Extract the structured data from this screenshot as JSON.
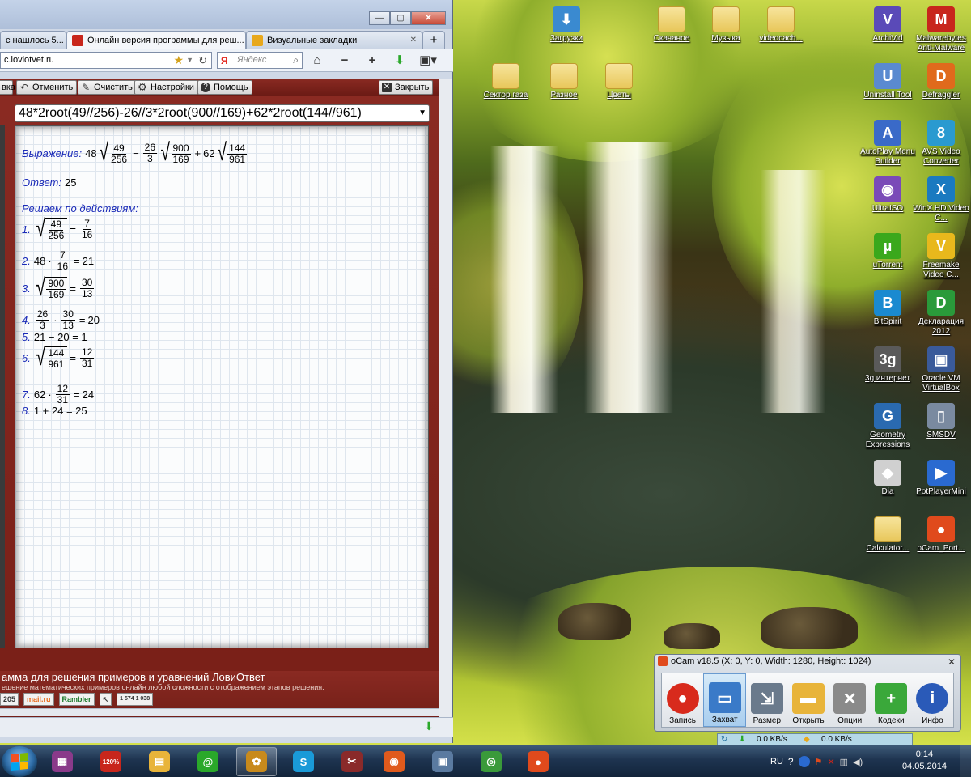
{
  "desktop": {
    "icons": [
      {
        "label": "Загрузки",
        "color": "#3a8ad0",
        "glyph": "⬇"
      },
      {
        "label": "Скачаное",
        "color": "folder",
        "glyph": ""
      },
      {
        "label": "Музыка",
        "color": "folder",
        "glyph": ""
      },
      {
        "label": "videocach...",
        "color": "folder",
        "glyph": ""
      },
      {
        "label": "ArchiVid",
        "color": "#5a4ab8",
        "glyph": "V"
      },
      {
        "label": "Malwarebytes Anti-Malware",
        "color": "#c8261c",
        "glyph": "M"
      },
      {
        "label": "Сектор газа",
        "color": "folder",
        "glyph": ""
      },
      {
        "label": "Разное",
        "color": "folder",
        "glyph": ""
      },
      {
        "label": "Цветы",
        "color": "folder",
        "glyph": ""
      },
      {
        "label": "Uninstall Tool",
        "color": "#5a8ad0",
        "glyph": "U"
      },
      {
        "label": "Defraggler",
        "color": "#e06a1c",
        "glyph": "D"
      },
      {
        "label": "AutoPlay Menu Builder",
        "color": "#3a6ac8",
        "glyph": "A"
      },
      {
        "label": "AVS Video Converter",
        "color": "#2a9ad0",
        "glyph": "8"
      },
      {
        "label": "UltraISO",
        "color": "#7a4ab8",
        "glyph": "◉"
      },
      {
        "label": "WinX HD Video C...",
        "color": "#1a7ac0",
        "glyph": "X"
      },
      {
        "label": "uTorrent",
        "color": "#3aa81c",
        "glyph": "µ"
      },
      {
        "label": "Freemake Video C...",
        "color": "#e8b81c",
        "glyph": "V"
      },
      {
        "label": "BitSpirit",
        "color": "#1a8ad0",
        "glyph": "B"
      },
      {
        "label": "Декларация 2012",
        "color": "#2a9a3a",
        "glyph": "D"
      },
      {
        "label": "3g интернет",
        "color": "#5a5a5a",
        "glyph": "3g"
      },
      {
        "label": "Oracle VM VirtualBox",
        "color": "#3a5a9a",
        "glyph": "▣"
      },
      {
        "label": "Geometry Expressions",
        "color": "#2a6ab0",
        "glyph": "G"
      },
      {
        "label": "SMSDV",
        "color": "#7a8aa0",
        "glyph": "▯"
      },
      {
        "label": "Dia",
        "color": "#d0d0d0",
        "glyph": "◆"
      },
      {
        "label": "PotPlayerMini",
        "color": "#2a6ad0",
        "glyph": "▶"
      },
      {
        "label": "Calculator...",
        "color": "folder",
        "glyph": ""
      },
      {
        "label": "oCam_Port...",
        "color": "#e04a1c",
        "glyph": "●"
      }
    ]
  },
  "browser": {
    "tabs": [
      {
        "label": "c нашлось 5...",
        "icon_color": "#3a6ad0"
      },
      {
        "label": "Онлайн версия программы для реш...",
        "icon_color": "#c8261c"
      },
      {
        "label": "Визуальные закладки",
        "icon_color": "#e8a81c"
      }
    ],
    "new_tab": "+",
    "url": "c.loviotvet.ru",
    "search_engine": "Я",
    "search_placeholder": "Яндекс",
    "nav_icons": [
      "home-icon",
      "zoom-out-icon",
      "zoom-in-icon",
      "download-icon",
      "bookmarks-icon"
    ]
  },
  "app": {
    "toolbar": {
      "cut_label": "вка",
      "undo_label": "Отменить",
      "clear_label": "Очистить",
      "settings_label": "Настройки",
      "help_label": "Помощь",
      "close_label": "Закрыть"
    },
    "expression_input": "48*2root(49//256)-26//3*2root(900//169)+62*2root(144//961)",
    "expression_label": "Выражение:",
    "answer_label": "Ответ:",
    "answer_value": "25",
    "steps_label": "Решаем по действиям:",
    "expression": {
      "a": "48",
      "r1n": "49",
      "r1d": "256",
      "op1": "−",
      "f1n": "26",
      "f1d": "3",
      "r2n": "900",
      "r2d": "169",
      "op2": "+",
      "b": "62",
      "r3n": "144",
      "r3d": "961"
    },
    "steps": [
      {
        "num": "1.",
        "kind": "sqrt",
        "n": "49",
        "d": "256",
        "rn": "7",
        "rd": "16"
      },
      {
        "num": "2.",
        "kind": "mulfrac",
        "a": "48",
        "n": "7",
        "d": "16",
        "res": "21"
      },
      {
        "num": "3.",
        "kind": "sqrt",
        "n": "900",
        "d": "169",
        "rn": "30",
        "rd": "13"
      },
      {
        "num": "4.",
        "kind": "fracfrac",
        "n1": "26",
        "d1": "3",
        "n2": "30",
        "d2": "13",
        "res": "20"
      },
      {
        "num": "5.",
        "kind": "plain",
        "text": "21 − 20 = 1"
      },
      {
        "num": "6.",
        "kind": "sqrt",
        "n": "144",
        "d": "961",
        "rn": "12",
        "rd": "31"
      },
      {
        "num": "7.",
        "kind": "mulfrac",
        "a": "62",
        "n": "12",
        "d": "31",
        "res": "24"
      },
      {
        "num": "8.",
        "kind": "plain",
        "text": "1 + 24 = 25"
      }
    ],
    "footer_title": "амма для решения примеров и уравнений ЛовиОтвет",
    "footer_sub": "ешение математических примеров онлайн любой сложности с отображением этапов решения.",
    "badges": [
      "205",
      "mail.ru",
      "Rambler",
      "↖",
      "1 574 1 038"
    ]
  },
  "ocam": {
    "title": "oCam v18.5 (X: 0, Y: 0, Width: 1280, Height: 1024)",
    "buttons": [
      {
        "label": "Запись",
        "color": "#d82a1c",
        "glyph": "●"
      },
      {
        "label": "Захват",
        "color": "#3a7ac8",
        "glyph": "▭"
      },
      {
        "label": "Размер",
        "color": "#6a7a8c",
        "glyph": "⇲"
      },
      {
        "label": "Открыть",
        "color": "#e8b43a",
        "glyph": "▬"
      },
      {
        "label": "Опции",
        "color": "#8a8a8a",
        "glyph": "✕"
      },
      {
        "label": "Кодеки",
        "color": "#3aa83a",
        "glyph": "+"
      },
      {
        "label": "Инфо",
        "color": "#2a5ab8",
        "glyph": "i"
      }
    ],
    "selected": "Захват",
    "net_down": "0.0 KB/s",
    "net_up": "0.0 KB/s"
  },
  "taskbar": {
    "items": [
      {
        "name": "winrar",
        "color": "#8a3a8a",
        "glyph": "▦"
      },
      {
        "name": "acrobat-120",
        "color": "#c8261c",
        "glyph": "120%"
      },
      {
        "name": "explorer",
        "color": "#e8b43a",
        "glyph": "▤"
      },
      {
        "name": "mail-agent",
        "color": "#2aa82a",
        "glyph": "@"
      },
      {
        "name": "bug-app",
        "color": "#c88a1c",
        "glyph": "✿"
      },
      {
        "name": "skype",
        "color": "#1a9ad8",
        "glyph": "S"
      },
      {
        "name": "media-app",
        "color": "#8a2a2a",
        "glyph": "✂"
      },
      {
        "name": "firefox",
        "color": "#e05a1c",
        "glyph": "◉"
      },
      {
        "name": "film-app",
        "color": "#5a7aa0",
        "glyph": "▣"
      },
      {
        "name": "chrome",
        "color": "#3a9a3a",
        "glyph": "◎"
      },
      {
        "name": "ocam",
        "color": "#e04a1c",
        "glyph": "●"
      }
    ],
    "lang": "RU",
    "time": "0:14",
    "date": "04.05.2014"
  }
}
